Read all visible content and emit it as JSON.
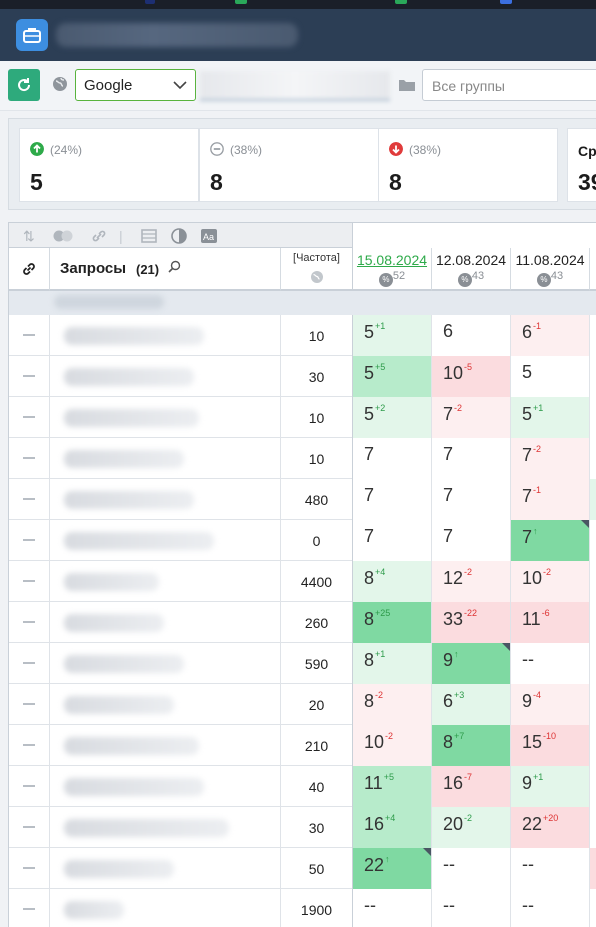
{
  "app": {
    "title": ""
  },
  "toolbar": {
    "engine": "Google",
    "groups_placeholder": "Все группы"
  },
  "stats": [
    {
      "pct": "(24%)",
      "value": "5",
      "icon": "arrow-up-icon",
      "color": "#2eaa4a"
    },
    {
      "pct": "(38%)",
      "value": "8",
      "icon": "minus-circle-icon",
      "color": "#9a9fa5"
    },
    {
      "pct": "(38%)",
      "value": "8",
      "icon": "arrow-down-icon",
      "color": "#e03b3b"
    },
    {
      "label": "Ср",
      "value": "39"
    }
  ],
  "table": {
    "queries_label": "Запросы",
    "queries_count": "(21)",
    "freq_label": "[Частота]",
    "dates": [
      {
        "date": "15.08.2024",
        "count": "52",
        "active": true
      },
      {
        "date": "12.08.2024",
        "count": "43",
        "active": false
      },
      {
        "date": "11.08.2024",
        "count": "43",
        "active": false
      }
    ],
    "rows": [
      {
        "freq": "10",
        "c": [
          {
            "v": "5",
            "d": "+1",
            "t": "up",
            "bg": "g1"
          },
          {
            "v": "6",
            "d": "",
            "t": "",
            "bg": "g0"
          },
          {
            "v": "6",
            "d": "-1",
            "t": "dn",
            "bg": "r1"
          }
        ]
      },
      {
        "freq": "30",
        "c": [
          {
            "v": "5",
            "d": "+5",
            "t": "up",
            "bg": "g2"
          },
          {
            "v": "10",
            "d": "-5",
            "t": "dn",
            "bg": "r2"
          },
          {
            "v": "5",
            "d": "",
            "t": "",
            "bg": "g0"
          }
        ]
      },
      {
        "freq": "10",
        "c": [
          {
            "v": "5",
            "d": "+2",
            "t": "up",
            "bg": "g1"
          },
          {
            "v": "7",
            "d": "-2",
            "t": "dn",
            "bg": "r1"
          },
          {
            "v": "5",
            "d": "+1",
            "t": "up",
            "bg": "g1"
          }
        ]
      },
      {
        "freq": "10",
        "c": [
          {
            "v": "7",
            "d": "",
            "t": "",
            "bg": "g0"
          },
          {
            "v": "7",
            "d": "",
            "t": "",
            "bg": "g0"
          },
          {
            "v": "7",
            "d": "-2",
            "t": "dn",
            "bg": "r1"
          }
        ]
      },
      {
        "freq": "480",
        "c": [
          {
            "v": "7",
            "d": "",
            "t": "",
            "bg": "g0"
          },
          {
            "v": "7",
            "d": "",
            "t": "",
            "bg": "g0"
          },
          {
            "v": "7",
            "d": "-1",
            "t": "dn",
            "bg": "r1"
          }
        ]
      },
      {
        "freq": "0",
        "c": [
          {
            "v": "7",
            "d": "",
            "t": "",
            "bg": "g0"
          },
          {
            "v": "7",
            "d": "",
            "t": "",
            "bg": "g0"
          },
          {
            "v": "7",
            "d": "↑",
            "t": "up",
            "bg": "g3",
            "corner": true
          }
        ]
      },
      {
        "freq": "4400",
        "c": [
          {
            "v": "8",
            "d": "+4",
            "t": "up",
            "bg": "g1"
          },
          {
            "v": "12",
            "d": "-2",
            "t": "dn",
            "bg": "r1"
          },
          {
            "v": "10",
            "d": "-2",
            "t": "dn",
            "bg": "r1"
          }
        ]
      },
      {
        "freq": "260",
        "c": [
          {
            "v": "8",
            "d": "+25",
            "t": "up",
            "bg": "g3"
          },
          {
            "v": "33",
            "d": "-22",
            "t": "dn",
            "bg": "r2"
          },
          {
            "v": "11",
            "d": "-6",
            "t": "dn",
            "bg": "r2"
          }
        ]
      },
      {
        "freq": "590",
        "c": [
          {
            "v": "8",
            "d": "+1",
            "t": "up",
            "bg": "g1"
          },
          {
            "v": "9",
            "d": "↑",
            "t": "up",
            "bg": "g3",
            "corner": true
          },
          {
            "v": "--",
            "d": "",
            "t": "",
            "bg": "g0"
          }
        ]
      },
      {
        "freq": "20",
        "c": [
          {
            "v": "8",
            "d": "-2",
            "t": "dn",
            "bg": "r1"
          },
          {
            "v": "6",
            "d": "+3",
            "t": "up",
            "bg": "g1"
          },
          {
            "v": "9",
            "d": "-4",
            "t": "dn",
            "bg": "r1"
          }
        ]
      },
      {
        "freq": "210",
        "c": [
          {
            "v": "10",
            "d": "-2",
            "t": "dn",
            "bg": "r1"
          },
          {
            "v": "8",
            "d": "+7",
            "t": "up",
            "bg": "g3"
          },
          {
            "v": "15",
            "d": "-10",
            "t": "dn",
            "bg": "r2"
          }
        ]
      },
      {
        "freq": "40",
        "c": [
          {
            "v": "11",
            "d": "+5",
            "t": "up",
            "bg": "g2"
          },
          {
            "v": "16",
            "d": "-7",
            "t": "dn",
            "bg": "r2"
          },
          {
            "v": "9",
            "d": "+1",
            "t": "up",
            "bg": "g1"
          }
        ]
      },
      {
        "freq": "30",
        "c": [
          {
            "v": "16",
            "d": "+4",
            "t": "up",
            "bg": "g2"
          },
          {
            "v": "20",
            "d": "-2",
            "t": "up",
            "bg": "g1"
          },
          {
            "v": "22",
            "d": "+20",
            "t": "dn",
            "bg": "r2"
          }
        ]
      },
      {
        "freq": "50",
        "c": [
          {
            "v": "22",
            "d": "↑",
            "t": "up",
            "bg": "g3",
            "corner": true
          },
          {
            "v": "--",
            "d": "",
            "t": "",
            "bg": "g0"
          },
          {
            "v": "--",
            "d": "",
            "t": "",
            "bg": "g0"
          }
        ]
      },
      {
        "freq": "1900",
        "c": [
          {
            "v": "--",
            "d": "",
            "t": "",
            "bg": "g0"
          },
          {
            "v": "--",
            "d": "",
            "t": "",
            "bg": "g0"
          },
          {
            "v": "--",
            "d": "",
            "t": "",
            "bg": "g0"
          }
        ]
      }
    ]
  }
}
